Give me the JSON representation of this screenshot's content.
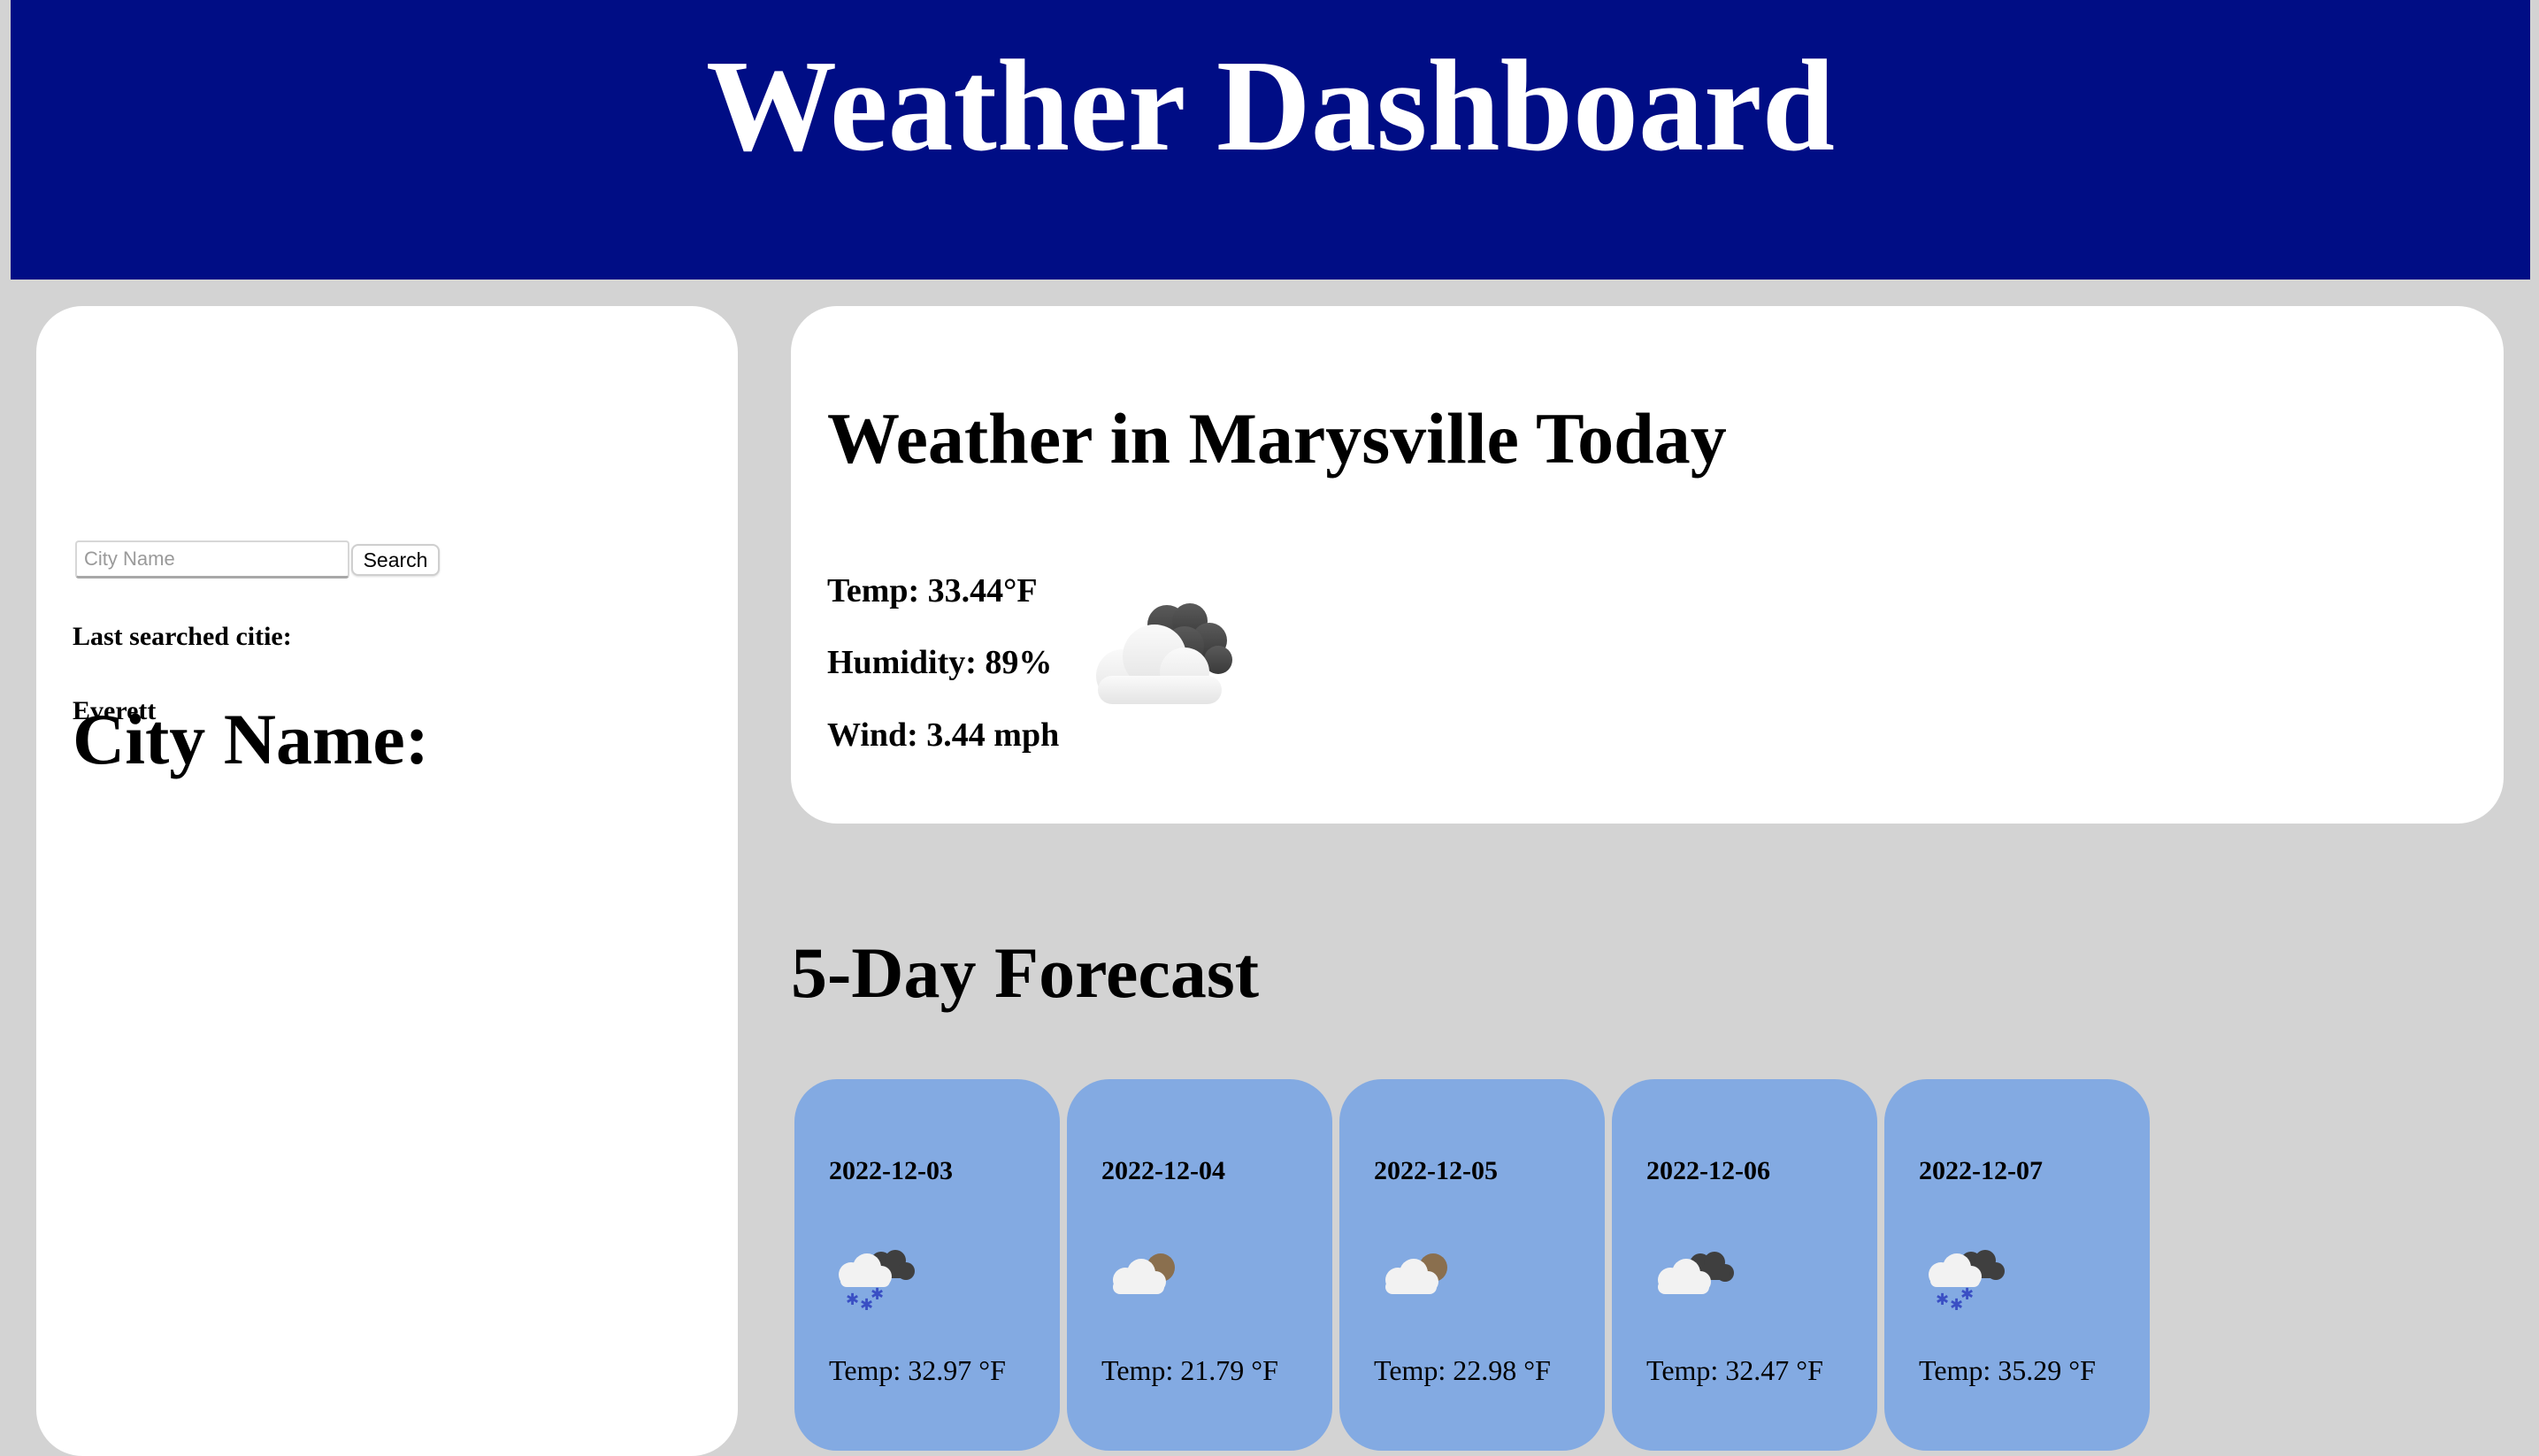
{
  "header": {
    "title": "Weather Dashboard",
    "background": "#000d85"
  },
  "sidebar": {
    "heading": "City Name:",
    "search": {
      "placeholder": "City Name",
      "value": "",
      "button_label": "Search"
    },
    "history_label": "Last searched citie:",
    "history": [
      "Everett"
    ]
  },
  "today": {
    "heading": "Weather in Marysville Today",
    "temp": "Temp: 33.44°F",
    "humidity": "Humidity: 89%",
    "wind": "Wind: 3.44 mph",
    "icon": "partly-cloudy-dark-icon"
  },
  "forecast": {
    "heading": "5-Day Forecast",
    "card_color": "#83aae2",
    "days": [
      {
        "date": "2022-12-03",
        "icon": "snow-icon",
        "temp": "Temp: 32.97 °F"
      },
      {
        "date": "2022-12-04",
        "icon": "cloud-sun-icon",
        "temp": "Temp: 21.79 °F"
      },
      {
        "date": "2022-12-05",
        "icon": "cloud-sun-icon",
        "temp": "Temp: 22.98 °F"
      },
      {
        "date": "2022-12-06",
        "icon": "cloudy-icon",
        "temp": "Temp: 32.47 °F"
      },
      {
        "date": "2022-12-07",
        "icon": "snow-icon",
        "temp": "Temp: 35.29 °F"
      }
    ]
  }
}
